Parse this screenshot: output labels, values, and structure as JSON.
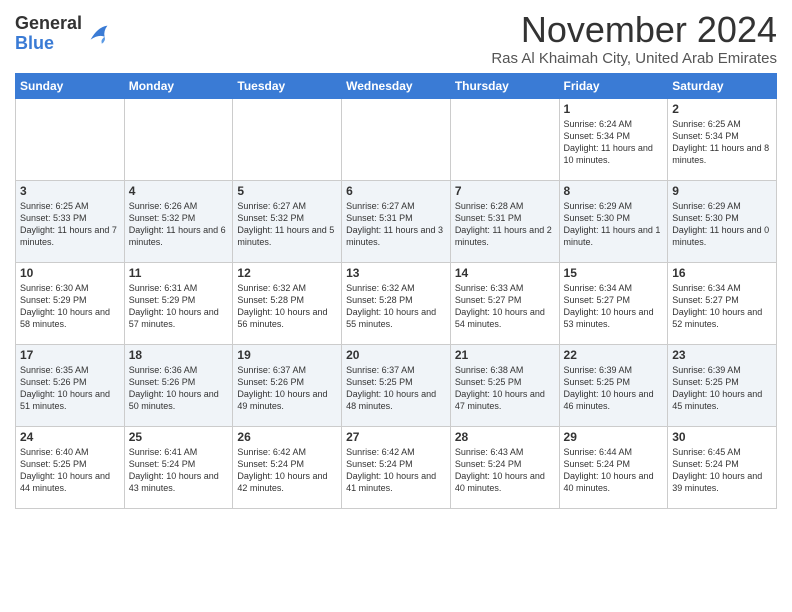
{
  "header": {
    "logo": {
      "general": "General",
      "blue": "Blue"
    },
    "title": "November 2024",
    "location": "Ras Al Khaimah City, United Arab Emirates"
  },
  "weekdays": [
    "Sunday",
    "Monday",
    "Tuesday",
    "Wednesday",
    "Thursday",
    "Friday",
    "Saturday"
  ],
  "weeks": [
    [
      {
        "day": "",
        "info": ""
      },
      {
        "day": "",
        "info": ""
      },
      {
        "day": "",
        "info": ""
      },
      {
        "day": "",
        "info": ""
      },
      {
        "day": "",
        "info": ""
      },
      {
        "day": "1",
        "info": "Sunrise: 6:24 AM\nSunset: 5:34 PM\nDaylight: 11 hours and 10 minutes."
      },
      {
        "day": "2",
        "info": "Sunrise: 6:25 AM\nSunset: 5:34 PM\nDaylight: 11 hours and 8 minutes."
      }
    ],
    [
      {
        "day": "3",
        "info": "Sunrise: 6:25 AM\nSunset: 5:33 PM\nDaylight: 11 hours and 7 minutes."
      },
      {
        "day": "4",
        "info": "Sunrise: 6:26 AM\nSunset: 5:32 PM\nDaylight: 11 hours and 6 minutes."
      },
      {
        "day": "5",
        "info": "Sunrise: 6:27 AM\nSunset: 5:32 PM\nDaylight: 11 hours and 5 minutes."
      },
      {
        "day": "6",
        "info": "Sunrise: 6:27 AM\nSunset: 5:31 PM\nDaylight: 11 hours and 3 minutes."
      },
      {
        "day": "7",
        "info": "Sunrise: 6:28 AM\nSunset: 5:31 PM\nDaylight: 11 hours and 2 minutes."
      },
      {
        "day": "8",
        "info": "Sunrise: 6:29 AM\nSunset: 5:30 PM\nDaylight: 11 hours and 1 minute."
      },
      {
        "day": "9",
        "info": "Sunrise: 6:29 AM\nSunset: 5:30 PM\nDaylight: 11 hours and 0 minutes."
      }
    ],
    [
      {
        "day": "10",
        "info": "Sunrise: 6:30 AM\nSunset: 5:29 PM\nDaylight: 10 hours and 58 minutes."
      },
      {
        "day": "11",
        "info": "Sunrise: 6:31 AM\nSunset: 5:29 PM\nDaylight: 10 hours and 57 minutes."
      },
      {
        "day": "12",
        "info": "Sunrise: 6:32 AM\nSunset: 5:28 PM\nDaylight: 10 hours and 56 minutes."
      },
      {
        "day": "13",
        "info": "Sunrise: 6:32 AM\nSunset: 5:28 PM\nDaylight: 10 hours and 55 minutes."
      },
      {
        "day": "14",
        "info": "Sunrise: 6:33 AM\nSunset: 5:27 PM\nDaylight: 10 hours and 54 minutes."
      },
      {
        "day": "15",
        "info": "Sunrise: 6:34 AM\nSunset: 5:27 PM\nDaylight: 10 hours and 53 minutes."
      },
      {
        "day": "16",
        "info": "Sunrise: 6:34 AM\nSunset: 5:27 PM\nDaylight: 10 hours and 52 minutes."
      }
    ],
    [
      {
        "day": "17",
        "info": "Sunrise: 6:35 AM\nSunset: 5:26 PM\nDaylight: 10 hours and 51 minutes."
      },
      {
        "day": "18",
        "info": "Sunrise: 6:36 AM\nSunset: 5:26 PM\nDaylight: 10 hours and 50 minutes."
      },
      {
        "day": "19",
        "info": "Sunrise: 6:37 AM\nSunset: 5:26 PM\nDaylight: 10 hours and 49 minutes."
      },
      {
        "day": "20",
        "info": "Sunrise: 6:37 AM\nSunset: 5:25 PM\nDaylight: 10 hours and 48 minutes."
      },
      {
        "day": "21",
        "info": "Sunrise: 6:38 AM\nSunset: 5:25 PM\nDaylight: 10 hours and 47 minutes."
      },
      {
        "day": "22",
        "info": "Sunrise: 6:39 AM\nSunset: 5:25 PM\nDaylight: 10 hours and 46 minutes."
      },
      {
        "day": "23",
        "info": "Sunrise: 6:39 AM\nSunset: 5:25 PM\nDaylight: 10 hours and 45 minutes."
      }
    ],
    [
      {
        "day": "24",
        "info": "Sunrise: 6:40 AM\nSunset: 5:25 PM\nDaylight: 10 hours and 44 minutes."
      },
      {
        "day": "25",
        "info": "Sunrise: 6:41 AM\nSunset: 5:24 PM\nDaylight: 10 hours and 43 minutes."
      },
      {
        "day": "26",
        "info": "Sunrise: 6:42 AM\nSunset: 5:24 PM\nDaylight: 10 hours and 42 minutes."
      },
      {
        "day": "27",
        "info": "Sunrise: 6:42 AM\nSunset: 5:24 PM\nDaylight: 10 hours and 41 minutes."
      },
      {
        "day": "28",
        "info": "Sunrise: 6:43 AM\nSunset: 5:24 PM\nDaylight: 10 hours and 40 minutes."
      },
      {
        "day": "29",
        "info": "Sunrise: 6:44 AM\nSunset: 5:24 PM\nDaylight: 10 hours and 40 minutes."
      },
      {
        "day": "30",
        "info": "Sunrise: 6:45 AM\nSunset: 5:24 PM\nDaylight: 10 hours and 39 minutes."
      }
    ]
  ]
}
